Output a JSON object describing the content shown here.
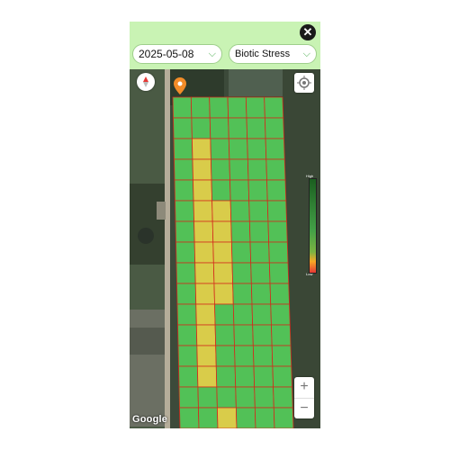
{
  "header": {
    "close_glyph": "✕",
    "date_value": "2025-05-08",
    "layer_value": "Biotic Stress",
    "chevron_glyph": "⌵"
  },
  "map": {
    "attribution": "Google",
    "zoom_in": "+",
    "zoom_out": "−",
    "legend_high": "High",
    "legend_low": "Low",
    "cell_colors": {
      "healthy": "#52c157",
      "stress": "#d9cc4a",
      "grid_line": "#d42a1c"
    },
    "stress_cells": [
      [
        2,
        1
      ],
      [
        3,
        1
      ],
      [
        4,
        1
      ],
      [
        5,
        1
      ],
      [
        5,
        2
      ],
      [
        6,
        1
      ],
      [
        6,
        2
      ],
      [
        7,
        1
      ],
      [
        7,
        2
      ],
      [
        8,
        1
      ],
      [
        8,
        2
      ],
      [
        9,
        1
      ],
      [
        9,
        2
      ],
      [
        10,
        1
      ],
      [
        11,
        1
      ],
      [
        12,
        1
      ],
      [
        13,
        1
      ],
      [
        15,
        2
      ]
    ],
    "icons": [
      "map-pin-icon",
      "compass-icon",
      "locate-icon"
    ]
  }
}
